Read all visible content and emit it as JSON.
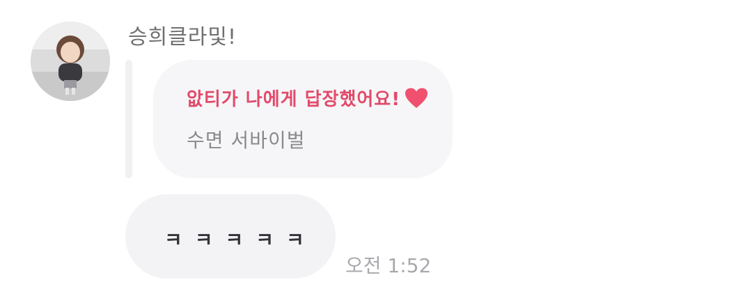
{
  "sender": {
    "name": "승희클라및!"
  },
  "reply": {
    "title": "앖티가 나에게 답장했어요!",
    "quoted_text": "수면 서바이벌",
    "accent_color": "#e24a6a",
    "heart_icon": "heart-icon"
  },
  "message": {
    "text": "ㅋㅋㅋㅋㅋ",
    "timestamp": "오전 1:52"
  }
}
